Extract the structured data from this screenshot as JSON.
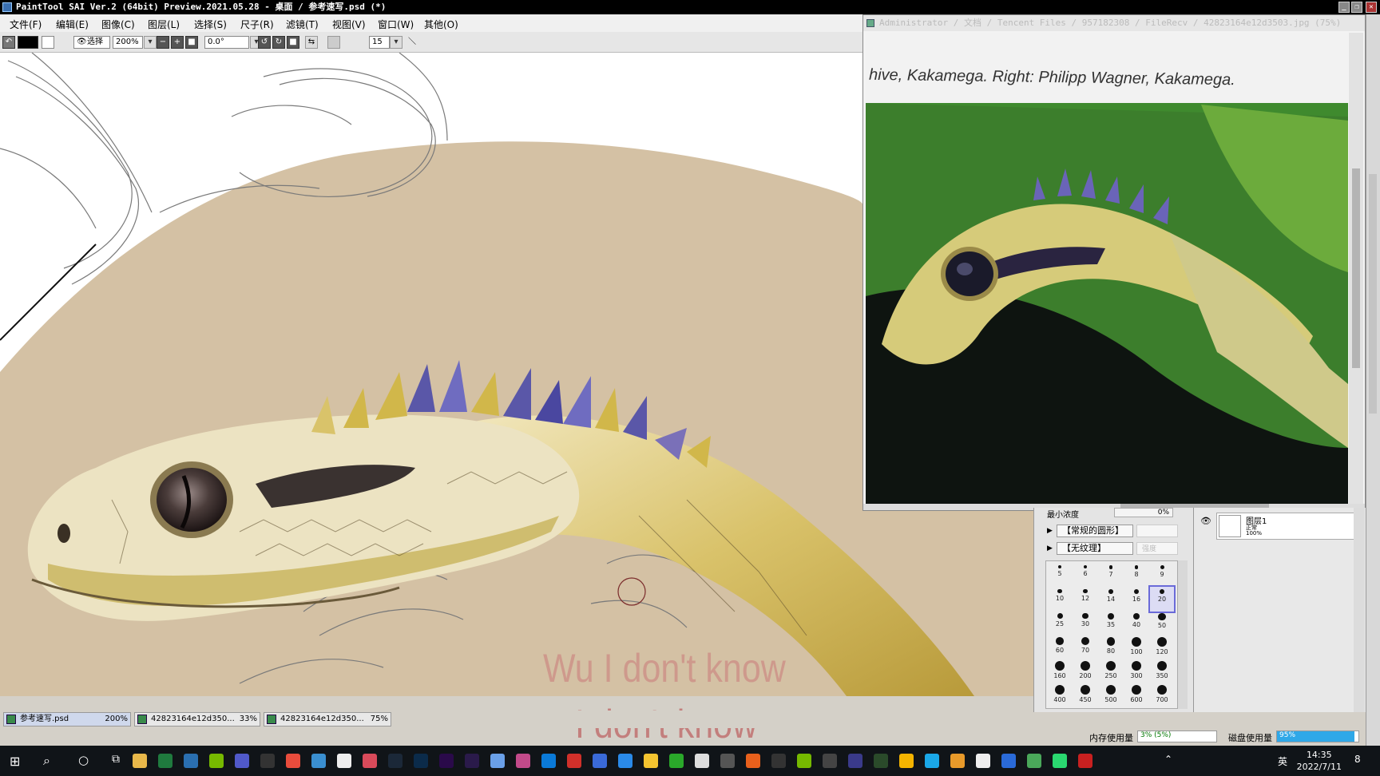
{
  "app": {
    "title": "PaintTool SAI Ver.2 (64bit) Preview.2021.05.28 - 桌面 / 参考速写.psd (*)"
  },
  "menu": {
    "items": [
      "文件(F)",
      "编辑(E)",
      "图像(C)",
      "图层(L)",
      "选择(S)",
      "尺子(R)",
      "滤镜(T)",
      "视图(V)",
      "窗口(W)",
      "其他(O)"
    ]
  },
  "toolbar": {
    "select_label": "选择",
    "zoom": "200%",
    "rotation": "0.0°",
    "brush_size": "15"
  },
  "canvas": {
    "lyric_line_1": "Wu I don't know",
    "lyric_line_2": "I don't know"
  },
  "doc_tabs": [
    {
      "name": "参考速写.psd",
      "zoom": "200%"
    },
    {
      "name": "42823164e12d350...",
      "zoom": "33%"
    },
    {
      "name": "42823164e12d350...",
      "zoom": "75%"
    }
  ],
  "viewer": {
    "title": "Administrator / 文档 / Tencent Files / 957182308 / FileRecv / 42823164e12d3503.jpg (75%)",
    "photo_caption": "hive, Kakamega. Right: Philipp Wagner, Kakamega."
  },
  "brush_panel": {
    "min_size_label": "最小浓度",
    "min_size_value": "0%",
    "shape_dropdown": "【常规的圆形】",
    "texture_dropdown": "【无纹理】",
    "texture_strength": "强度",
    "sizes": [
      "5",
      "6",
      "7",
      "8",
      "9",
      "10",
      "12",
      "14",
      "16",
      "20",
      "25",
      "30",
      "35",
      "40",
      "50",
      "60",
      "70",
      "80",
      "100",
      "120",
      "160",
      "200",
      "250",
      "300",
      "350",
      "400",
      "450",
      "500",
      "600",
      "700"
    ],
    "selected_size": "20"
  },
  "layer_panel": {
    "layer_name": "图层1",
    "layer_mode": "正常",
    "layer_opacity": "100%"
  },
  "status": {
    "memory_label": "内存使用量",
    "memory_value": "3% (5%)",
    "disk_label": "磁盘使用量",
    "disk_value": "95%",
    "disk_fraction": 0.95
  },
  "taskbar": {
    "ime": "英",
    "time": "14:35",
    "date": "2022/7/11",
    "notification_count": "8"
  },
  "colors": {
    "canvas_bg": "#d4c1a4",
    "scale_yellow": "#c9b44a",
    "spine_purple": "#5a57a8"
  }
}
